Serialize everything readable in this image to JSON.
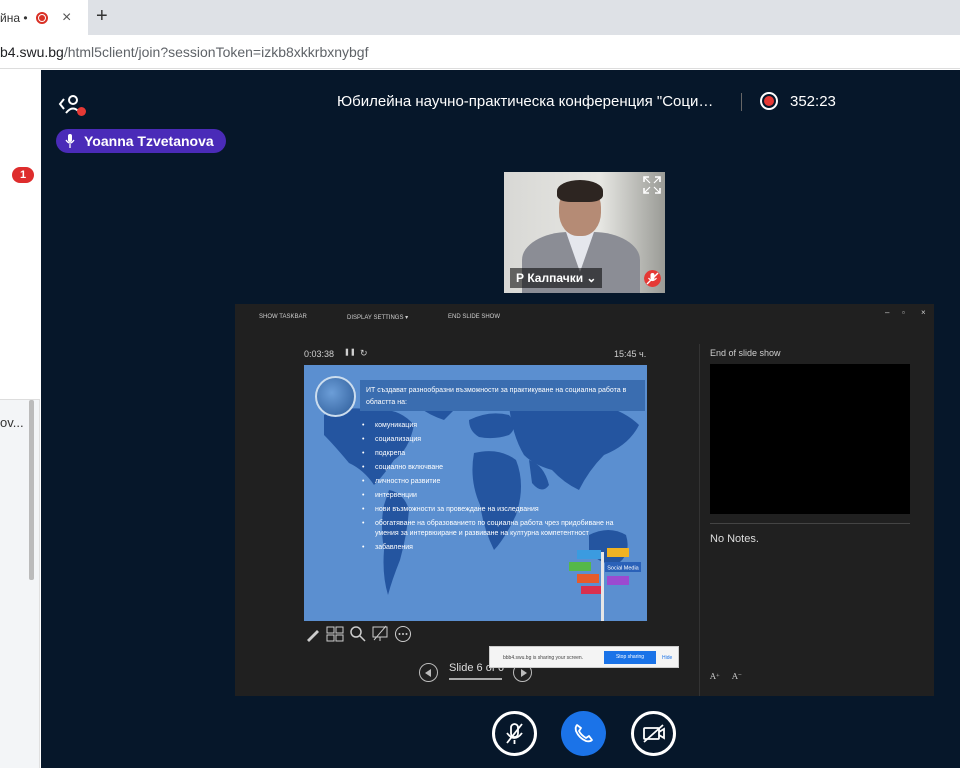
{
  "browser": {
    "tab_title": "йна •",
    "tab_close": "×",
    "new_tab": "+",
    "url_host": "b4.swu.bg",
    "url_path": "/html5client/join?sessionToken=izkb8xkkrbxnybgf"
  },
  "sidebar": {
    "unread_badge": "1",
    "truncated_item": "ov..."
  },
  "header": {
    "meeting_title": "Юбилейна научно-практическа конференция \"Соци…",
    "recording_time": "352:23"
  },
  "talking_indicator": {
    "name": "Yoanna Tzvetanova"
  },
  "webcam": {
    "participant_name": "Р Калпачки ⌄"
  },
  "presentation": {
    "toolbar": {
      "show_taskbar": "SHOW TASKBAR",
      "display_settings": "DISPLAY SETTINGS ▾",
      "end_slide_show": "END SLIDE SHOW"
    },
    "window_controls": [
      "–",
      "▫",
      "×"
    ],
    "elapsed": "0:03:38",
    "pause_icon": "❚❚",
    "restart_icon": "↻",
    "clock": "15:45 ч.",
    "slide": {
      "heading": "ИТ   създават разнообразни възможности за практикуване на социална работа   в   областта   на:",
      "bullets": [
        "комуникация",
        "социализация",
        "подкрепа",
        "социално включване",
        "личностно  развитие",
        "интервенции",
        "нови  възможности   за   провеждане   на изследвания",
        "обогатяване на образованието по социална работа чрез придобиване на умения за интервюиране и развиване на културна компетентност",
        "забавления"
      ],
      "sign_label": "Social Media"
    },
    "slide_counter": "Slide 6 of 6",
    "next_slide_label": "End of slide show",
    "notes": "No Notes.",
    "font_controls": [
      "A⁺",
      "A⁻"
    ],
    "share_notice": {
      "text": "bbb4.swu.bg is sharing your screen.",
      "stop_label": "Stop sharing",
      "hide_label": "Hide"
    }
  },
  "colors": {
    "background": "#06172a",
    "accent_blue": "#1b73e8",
    "talking_purple": "#4a2bb8",
    "record_red": "#e53935"
  }
}
